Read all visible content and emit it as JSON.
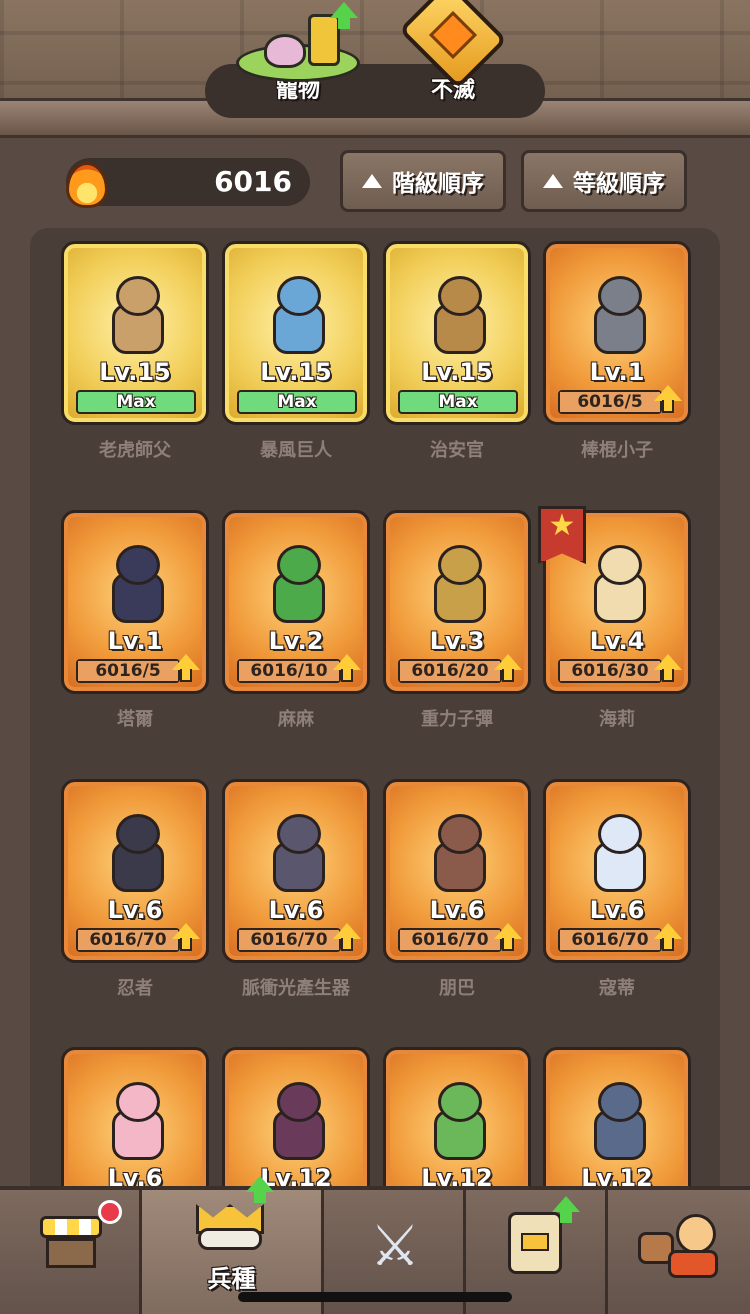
{
  "top_tabs": [
    {
      "label": "寵物",
      "icon": "pet-habitat-icon",
      "has_upgrade": true
    },
    {
      "label": "不滅",
      "icon": "immortal-gem-icon",
      "has_upgrade": false
    }
  ],
  "resource": {
    "icon": "flame-icon",
    "value": "6016"
  },
  "sort_buttons": [
    {
      "label": "階級順序",
      "icon": "triangle-up-icon"
    },
    {
      "label": "等級順序",
      "icon": "triangle-up-icon"
    }
  ],
  "heroes": [
    {
      "name": "老虎師父",
      "level": "15",
      "progress": "Max",
      "max": true,
      "rarity": "gold"
    },
    {
      "name": "暴風巨人",
      "level": "15",
      "progress": "Max",
      "max": true,
      "rarity": "gold"
    },
    {
      "name": "治安官",
      "level": "15",
      "progress": "Max",
      "max": true,
      "rarity": "gold"
    },
    {
      "name": "棒棍小子",
      "level": "1",
      "progress": "6016/5",
      "max": false,
      "rarity": "orange"
    },
    {
      "name": "塔爾",
      "level": "1",
      "progress": "6016/5",
      "max": false,
      "rarity": "orange"
    },
    {
      "name": "麻麻",
      "level": "2",
      "progress": "6016/10",
      "max": false,
      "rarity": "orange"
    },
    {
      "name": "重力子彈",
      "level": "3",
      "progress": "6016/20",
      "max": false,
      "rarity": "orange"
    },
    {
      "name": "海莉",
      "level": "4",
      "progress": "6016/30",
      "max": false,
      "rarity": "orange",
      "starred": true
    },
    {
      "name": "忍者",
      "level": "6",
      "progress": "6016/70",
      "max": false,
      "rarity": "orange"
    },
    {
      "name": "脈衝光產生器",
      "level": "6",
      "progress": "6016/70",
      "max": false,
      "rarity": "orange"
    },
    {
      "name": "朋巴",
      "level": "6",
      "progress": "6016/70",
      "max": false,
      "rarity": "orange"
    },
    {
      "name": "寇蒂",
      "level": "6",
      "progress": "6016/70",
      "max": false,
      "rarity": "orange"
    },
    {
      "name": "",
      "level": "6",
      "progress": "",
      "max": false,
      "rarity": "orange"
    },
    {
      "name": "",
      "level": "12",
      "progress": "",
      "max": false,
      "rarity": "orange"
    },
    {
      "name": "",
      "level": "12",
      "progress": "",
      "max": false,
      "rarity": "orange"
    },
    {
      "name": "",
      "level": "12",
      "progress": "",
      "max": false,
      "rarity": "orange"
    }
  ],
  "lv_prefix": "Lv.",
  "bottom_nav": [
    {
      "id": "shop",
      "label": "",
      "icon": "shop-stall-icon",
      "badge": true
    },
    {
      "id": "heroes",
      "label": "兵種",
      "icon": "crown-icon",
      "active": true,
      "has_upgrade": true
    },
    {
      "id": "battle",
      "label": "",
      "icon": "crossed-swords-icon"
    },
    {
      "id": "cards",
      "label": "",
      "icon": "card-icon",
      "has_upgrade": true
    },
    {
      "id": "guild",
      "label": "",
      "icon": "characters-icon"
    }
  ],
  "colors": {
    "background": "#5a4a44",
    "panel": "#4a3e39",
    "gold_card": "#f2cf5a",
    "orange_card": "#f09a3a",
    "max_bar": "#6fdb7c",
    "upgrade_arrow": "#ffcc3a",
    "green_arrow": "#55d34b"
  }
}
